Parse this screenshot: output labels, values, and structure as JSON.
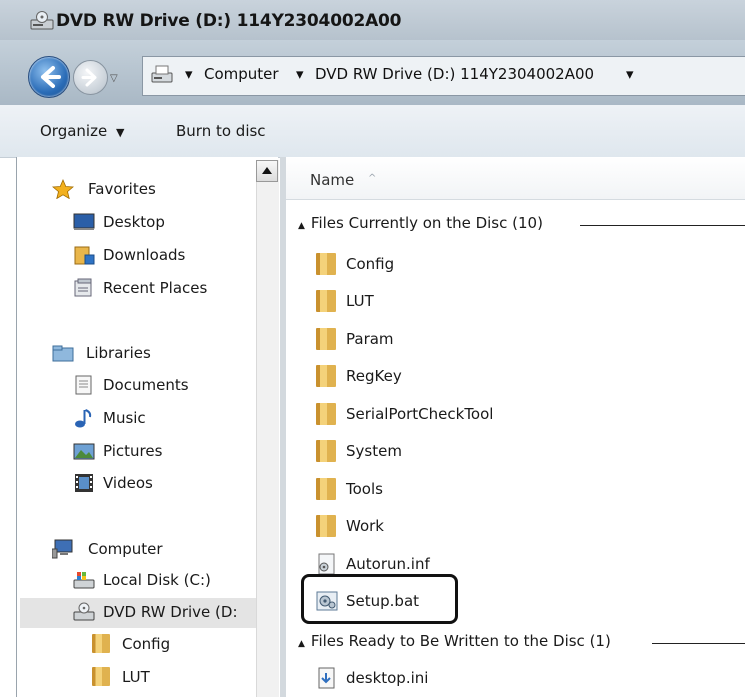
{
  "window": {
    "title": "DVD RW Drive (D:) 114Y2304002A00"
  },
  "address": {
    "crumbs": [
      "Computer",
      "DVD RW Drive (D:) 114Y2304002A00"
    ]
  },
  "toolbar": {
    "organize_label": "Organize",
    "burn_label": "Burn to disc"
  },
  "nav": {
    "favorites": {
      "label": "Favorites",
      "items": [
        "Desktop",
        "Downloads",
        "Recent Places"
      ]
    },
    "libraries": {
      "label": "Libraries",
      "items": [
        "Documents",
        "Music",
        "Pictures",
        "Videos"
      ]
    },
    "computer": {
      "label": "Computer",
      "items": [
        "Local Disk (C:)",
        "DVD RW Drive (D:",
        "Config",
        "LUT"
      ]
    }
  },
  "content": {
    "column_name": "Name",
    "group_on_disc": "Files Currently on the Disc (10)",
    "group_to_write": "Files Ready to Be Written to the Disc (1)",
    "files_on_disc": [
      "Config",
      "LUT",
      "Param",
      "RegKey",
      "SerialPortCheckTool",
      "System",
      "Tools",
      "Work",
      "Autorun.inf",
      "Setup.bat"
    ],
    "files_to_write": [
      "desktop.ini"
    ]
  }
}
